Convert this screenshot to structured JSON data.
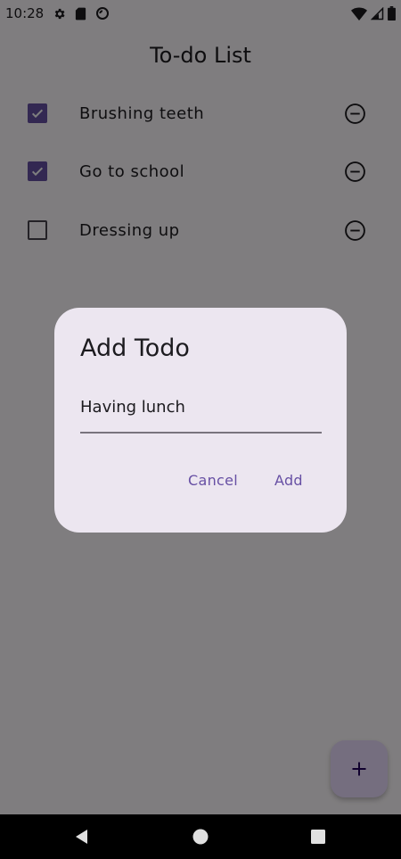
{
  "status_bar": {
    "time": "10:28",
    "icons_left": [
      "gear-icon",
      "sd-card-icon",
      "no-disturb-icon"
    ],
    "icons_right": [
      "wifi-icon",
      "signal-icon",
      "battery-icon"
    ]
  },
  "header": {
    "title": "To-do List"
  },
  "todos": [
    {
      "label": "Brushing teeth",
      "checked": true
    },
    {
      "label": "Go to school",
      "checked": true
    },
    {
      "label": "Dressing up",
      "checked": false
    }
  ],
  "dialog": {
    "title": "Add Todo",
    "input_value": "Having lunch",
    "cancel_label": "Cancel",
    "add_label": "Add"
  },
  "fab": {
    "icon": "plus-icon"
  },
  "nav_bar": {
    "icons": [
      "back-icon",
      "home-icon",
      "recents-icon"
    ]
  },
  "colors": {
    "accent": "#6750a4",
    "dialog_bg": "#ece6f0",
    "fab_bg": "#eaddff"
  }
}
